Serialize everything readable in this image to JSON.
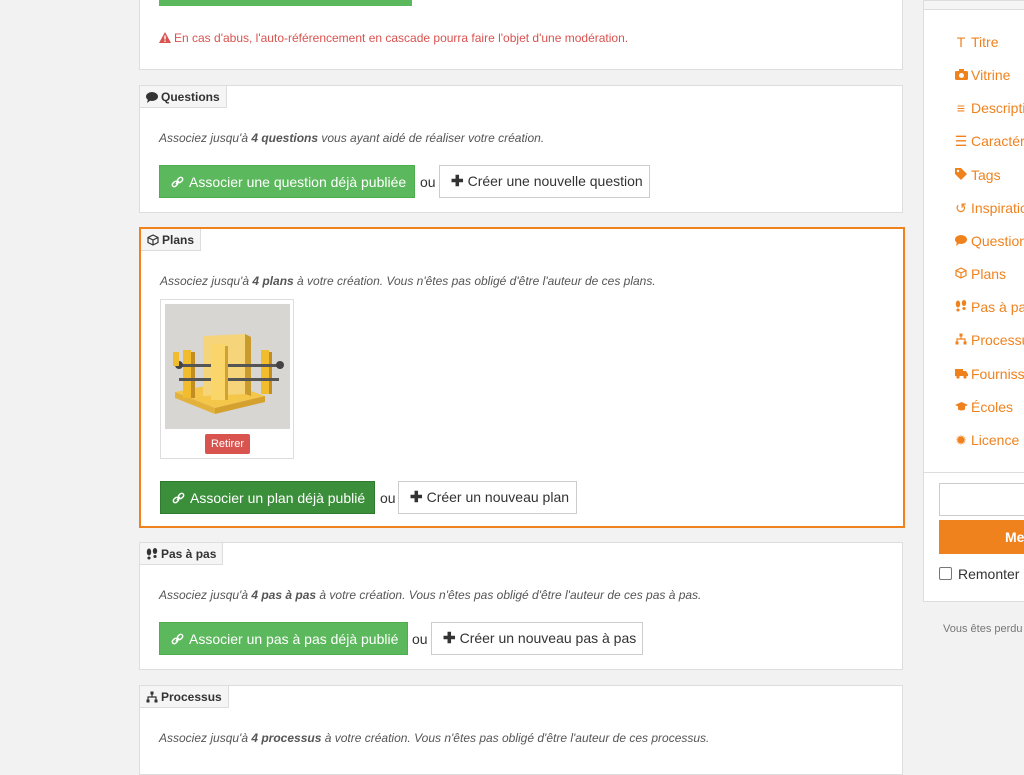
{
  "top": {
    "warning_text": "En cas d'abus, l'auto-référencement en cascade pourra faire l'objet d'une modération."
  },
  "questions": {
    "tab_label": "Questions",
    "desc_pre": "Associez jusqu'à ",
    "desc_bold": "4 questions",
    "desc_post": " vous ayant aidé de réaliser votre création.",
    "associate_label": "Associer une question déjà publiée",
    "or_label": "ou",
    "create_label": "Créer une nouvelle question"
  },
  "plans": {
    "tab_label": "Plans",
    "desc_pre": "Associez jusqu'à ",
    "desc_bold": "4 plans",
    "desc_post": " à votre création. Vous n'êtes pas obligé d'être l'auteur de ces plans.",
    "remove_label": "Retirer",
    "associate_label": "Associer un plan déjà publié",
    "or_label": "ou",
    "create_label": "Créer un nouveau plan"
  },
  "pas_a_pas": {
    "tab_label": "Pas à pas",
    "desc_pre": "Associez jusqu'à ",
    "desc_bold": "4 pas à pas",
    "desc_post": " à votre création. Vous n'êtes pas obligé d'être l'auteur de ces pas à pas.",
    "associate_label": "Associer un pas à pas déjà publié",
    "or_label": "ou",
    "create_label": "Créer un nouveau pas à pas"
  },
  "processus": {
    "tab_label": "Processus",
    "desc_pre": "Associez jusqu'à ",
    "desc_bold": "4 processus",
    "desc_post": " à votre création. Vous n'êtes pas obligé d'être l'auteur de ces processus."
  },
  "sidebar": {
    "items": [
      {
        "label": "Titre",
        "icon": "title-icon"
      },
      {
        "label": "Vitrine",
        "icon": "camera-icon"
      },
      {
        "label": "Descripti",
        "icon": "paragraph-icon"
      },
      {
        "label": "Caractér",
        "icon": "list-icon"
      },
      {
        "label": "Tags",
        "icon": "tag-icon"
      },
      {
        "label": "Inspiratio",
        "icon": "inspiration-icon"
      },
      {
        "label": "Question",
        "icon": "speech-bubble-icon"
      },
      {
        "label": "Plans",
        "icon": "cube-icon"
      },
      {
        "label": "Pas à pa",
        "icon": "footsteps-icon"
      },
      {
        "label": "Processu",
        "icon": "sitemap-icon"
      },
      {
        "label": "Fourniss",
        "icon": "truck-icon"
      },
      {
        "label": "Écoles",
        "icon": "graduation-cap-icon"
      },
      {
        "label": "Licence",
        "icon": "certificate-icon"
      }
    ],
    "submit_label": "Me",
    "remonter_label": "Remonter l",
    "status_text": "Vous êtes perdu"
  },
  "colors": {
    "accent": "#f0821e",
    "green": "#5cb85c",
    "danger": "#d9534f"
  }
}
